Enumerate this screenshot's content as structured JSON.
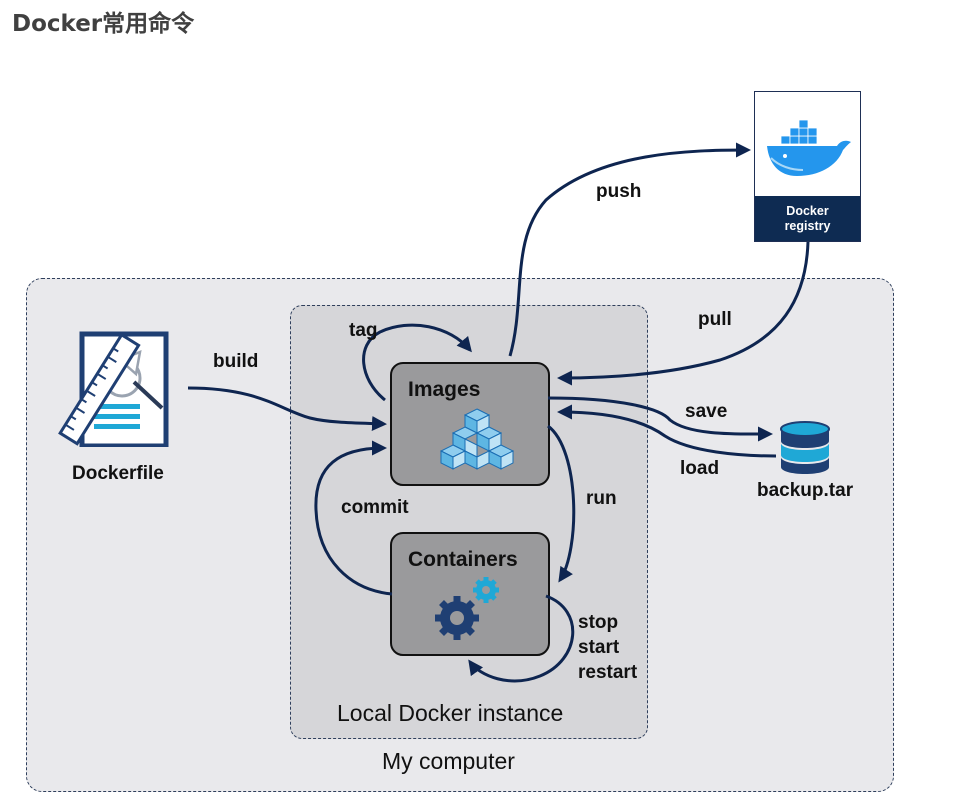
{
  "title": "Docker常用命令",
  "boxes": {
    "my_computer": "My computer",
    "local_instance": "Local Docker instance"
  },
  "nodes": {
    "images": "Images",
    "containers": "Containers",
    "dockerfile": "Dockerfile",
    "backup": "backup.tar",
    "registry_line1": "Docker",
    "registry_line2": "registry"
  },
  "commands": {
    "push": "push",
    "pull": "pull",
    "tag": "tag",
    "build": "build",
    "save": "save",
    "load": "load",
    "commit": "commit",
    "run": "run",
    "stop": "stop",
    "start": "start",
    "restart": "restart"
  },
  "colors": {
    "arrow": "#0e2550",
    "registry_band": "#0e2b52",
    "accent_cyan": "#1fa8d6",
    "gear": "#1f3f73"
  },
  "icons": [
    "docker-whale-icon",
    "dockerfile-icon",
    "image-layers-icon",
    "gears-icon",
    "database-icon"
  ]
}
